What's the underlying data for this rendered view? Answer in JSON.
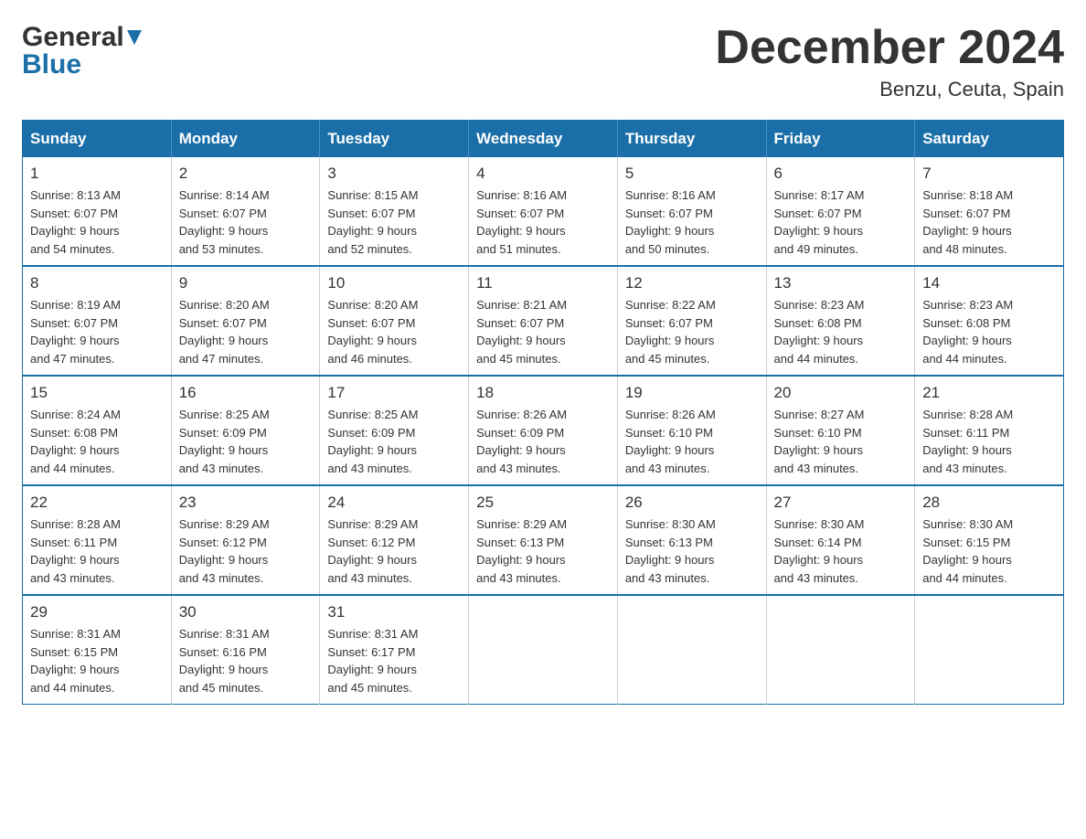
{
  "brand": {
    "name_general": "General",
    "name_blue": "Blue"
  },
  "title": "December 2024",
  "subtitle": "Benzu, Ceuta, Spain",
  "days_of_week": [
    "Sunday",
    "Monday",
    "Tuesday",
    "Wednesday",
    "Thursday",
    "Friday",
    "Saturday"
  ],
  "weeks": [
    [
      {
        "day": "1",
        "sunrise": "8:13 AM",
        "sunset": "6:07 PM",
        "daylight": "9 hours and 54 minutes."
      },
      {
        "day": "2",
        "sunrise": "8:14 AM",
        "sunset": "6:07 PM",
        "daylight": "9 hours and 53 minutes."
      },
      {
        "day": "3",
        "sunrise": "8:15 AM",
        "sunset": "6:07 PM",
        "daylight": "9 hours and 52 minutes."
      },
      {
        "day": "4",
        "sunrise": "8:16 AM",
        "sunset": "6:07 PM",
        "daylight": "9 hours and 51 minutes."
      },
      {
        "day": "5",
        "sunrise": "8:16 AM",
        "sunset": "6:07 PM",
        "daylight": "9 hours and 50 minutes."
      },
      {
        "day": "6",
        "sunrise": "8:17 AM",
        "sunset": "6:07 PM",
        "daylight": "9 hours and 49 minutes."
      },
      {
        "day": "7",
        "sunrise": "8:18 AM",
        "sunset": "6:07 PM",
        "daylight": "9 hours and 48 minutes."
      }
    ],
    [
      {
        "day": "8",
        "sunrise": "8:19 AM",
        "sunset": "6:07 PM",
        "daylight": "9 hours and 47 minutes."
      },
      {
        "day": "9",
        "sunrise": "8:20 AM",
        "sunset": "6:07 PM",
        "daylight": "9 hours and 47 minutes."
      },
      {
        "day": "10",
        "sunrise": "8:20 AM",
        "sunset": "6:07 PM",
        "daylight": "9 hours and 46 minutes."
      },
      {
        "day": "11",
        "sunrise": "8:21 AM",
        "sunset": "6:07 PM",
        "daylight": "9 hours and 45 minutes."
      },
      {
        "day": "12",
        "sunrise": "8:22 AM",
        "sunset": "6:07 PM",
        "daylight": "9 hours and 45 minutes."
      },
      {
        "day": "13",
        "sunrise": "8:23 AM",
        "sunset": "6:08 PM",
        "daylight": "9 hours and 44 minutes."
      },
      {
        "day": "14",
        "sunrise": "8:23 AM",
        "sunset": "6:08 PM",
        "daylight": "9 hours and 44 minutes."
      }
    ],
    [
      {
        "day": "15",
        "sunrise": "8:24 AM",
        "sunset": "6:08 PM",
        "daylight": "9 hours and 44 minutes."
      },
      {
        "day": "16",
        "sunrise": "8:25 AM",
        "sunset": "6:09 PM",
        "daylight": "9 hours and 43 minutes."
      },
      {
        "day": "17",
        "sunrise": "8:25 AM",
        "sunset": "6:09 PM",
        "daylight": "9 hours and 43 minutes."
      },
      {
        "day": "18",
        "sunrise": "8:26 AM",
        "sunset": "6:09 PM",
        "daylight": "9 hours and 43 minutes."
      },
      {
        "day": "19",
        "sunrise": "8:26 AM",
        "sunset": "6:10 PM",
        "daylight": "9 hours and 43 minutes."
      },
      {
        "day": "20",
        "sunrise": "8:27 AM",
        "sunset": "6:10 PM",
        "daylight": "9 hours and 43 minutes."
      },
      {
        "day": "21",
        "sunrise": "8:28 AM",
        "sunset": "6:11 PM",
        "daylight": "9 hours and 43 minutes."
      }
    ],
    [
      {
        "day": "22",
        "sunrise": "8:28 AM",
        "sunset": "6:11 PM",
        "daylight": "9 hours and 43 minutes."
      },
      {
        "day": "23",
        "sunrise": "8:29 AM",
        "sunset": "6:12 PM",
        "daylight": "9 hours and 43 minutes."
      },
      {
        "day": "24",
        "sunrise": "8:29 AM",
        "sunset": "6:12 PM",
        "daylight": "9 hours and 43 minutes."
      },
      {
        "day": "25",
        "sunrise": "8:29 AM",
        "sunset": "6:13 PM",
        "daylight": "9 hours and 43 minutes."
      },
      {
        "day": "26",
        "sunrise": "8:30 AM",
        "sunset": "6:13 PM",
        "daylight": "9 hours and 43 minutes."
      },
      {
        "day": "27",
        "sunrise": "8:30 AM",
        "sunset": "6:14 PM",
        "daylight": "9 hours and 43 minutes."
      },
      {
        "day": "28",
        "sunrise": "8:30 AM",
        "sunset": "6:15 PM",
        "daylight": "9 hours and 44 minutes."
      }
    ],
    [
      {
        "day": "29",
        "sunrise": "8:31 AM",
        "sunset": "6:15 PM",
        "daylight": "9 hours and 44 minutes."
      },
      {
        "day": "30",
        "sunrise": "8:31 AM",
        "sunset": "6:16 PM",
        "daylight": "9 hours and 45 minutes."
      },
      {
        "day": "31",
        "sunrise": "8:31 AM",
        "sunset": "6:17 PM",
        "daylight": "9 hours and 45 minutes."
      },
      null,
      null,
      null,
      null
    ]
  ],
  "labels": {
    "sunrise": "Sunrise:",
    "sunset": "Sunset:",
    "daylight": "Daylight:"
  }
}
